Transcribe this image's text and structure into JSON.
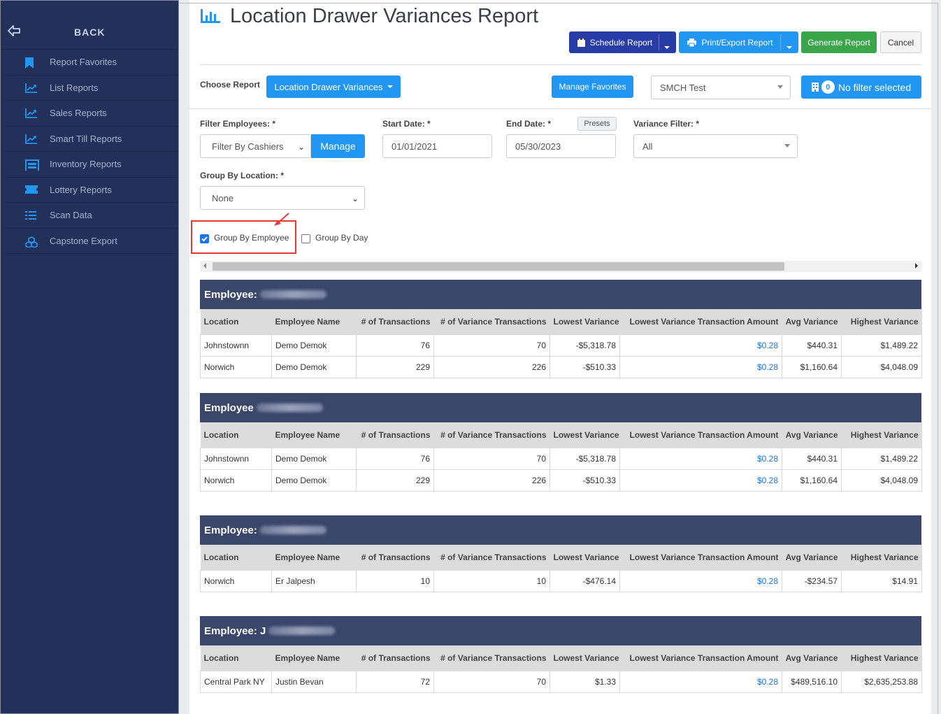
{
  "sidebar": {
    "back_label": "BACK",
    "items": [
      {
        "label": "Report Favorites",
        "icon": "bookmark-icon"
      },
      {
        "label": "List Reports",
        "icon": "chart-line-icon"
      },
      {
        "label": "Sales Reports",
        "icon": "chart-line-icon"
      },
      {
        "label": "Smart Till Reports",
        "icon": "chart-line-icon"
      },
      {
        "label": "Inventory Reports",
        "icon": "warehouse-icon"
      },
      {
        "label": "Lottery Reports",
        "icon": "ticket-icon"
      },
      {
        "label": "Scan Data",
        "icon": "list-icon"
      },
      {
        "label": "Capstone Export",
        "icon": "cubes-icon"
      }
    ]
  },
  "header": {
    "title": "Location Drawer Variances Report",
    "schedule_label": "Schedule Report",
    "print_label": "Print/Export Report",
    "generate_label": "Generate Report",
    "cancel_label": "Cancel"
  },
  "report_bar": {
    "choose_label": "Choose Report",
    "report_selected": "Location Drawer Variances",
    "manage_favorites_label": "Manage Favorites",
    "store_selected": "SMCH Test",
    "filter_count": "0",
    "filter_label": "No filter selected"
  },
  "filters": {
    "employees_label": "Filter Employees: *",
    "employees_value": "Filter By Cashiers",
    "manage_label": "Manage",
    "start_label": "Start Date: *",
    "start_value": "01/01/2021",
    "end_label": "End Date: *",
    "presets_label": "Presets",
    "end_value": "05/30/2023",
    "variance_label": "Variance Filter: *",
    "variance_value": "All",
    "group_location_label": "Group By Location: *",
    "group_location_value": "None",
    "group_employee_label": "Group By Employee",
    "group_employee_checked": true,
    "group_day_label": "Group By Day",
    "group_day_checked": false
  },
  "columns": [
    "Location",
    "Employee Name",
    "# of Transactions",
    "# of Variance Transactions",
    "Lowest Variance",
    "Lowest Variance Transaction Amount",
    "Avg Variance",
    "Highest Variance"
  ],
  "groups": [
    {
      "heading": "Employee:",
      "rows": [
        {
          "location": "Johnstownn",
          "employee": "Demo Demok",
          "transactions": "76",
          "variance_transactions": "70",
          "lowest": "-$5,318.78",
          "lowest_amount": "$0.28",
          "avg": "$440.31",
          "highest": "$1,489.22"
        },
        {
          "location": "Norwich",
          "employee": "Demo Demok",
          "transactions": "229",
          "variance_transactions": "226",
          "lowest": "-$510.33",
          "lowest_amount": "$0.28",
          "avg": "$1,160.64",
          "highest": "$4,048.09"
        }
      ]
    },
    {
      "heading": "Employee",
      "rows": [
        {
          "location": "Johnstownn",
          "employee": "Demo Demok",
          "transactions": "76",
          "variance_transactions": "70",
          "lowest": "-$5,318.78",
          "lowest_amount": "$0.28",
          "avg": "$440.31",
          "highest": "$1,489.22"
        },
        {
          "location": "Norwich",
          "employee": "Demo Demok",
          "transactions": "229",
          "variance_transactions": "226",
          "lowest": "-$510.33",
          "lowest_amount": "$0.28",
          "avg": "$1,160.64",
          "highest": "$4,048.09"
        }
      ]
    },
    {
      "heading": "Employee:",
      "rows": [
        {
          "location": "Norwich",
          "employee": "Er Jalpesh",
          "transactions": "10",
          "variance_transactions": "10",
          "lowest": "-$476.14",
          "lowest_amount": "$0.28",
          "avg": "-$234.57",
          "highest": "$14.91"
        }
      ]
    },
    {
      "heading": "Employee: J",
      "rows": [
        {
          "location": "Central Park NY",
          "employee": "Justin Bevan",
          "transactions": "72",
          "variance_transactions": "70",
          "lowest": "$1.33",
          "lowest_amount": "$0.28",
          "avg": "$489,516.10",
          "highest": "$2,635,253.88"
        }
      ]
    }
  ]
}
